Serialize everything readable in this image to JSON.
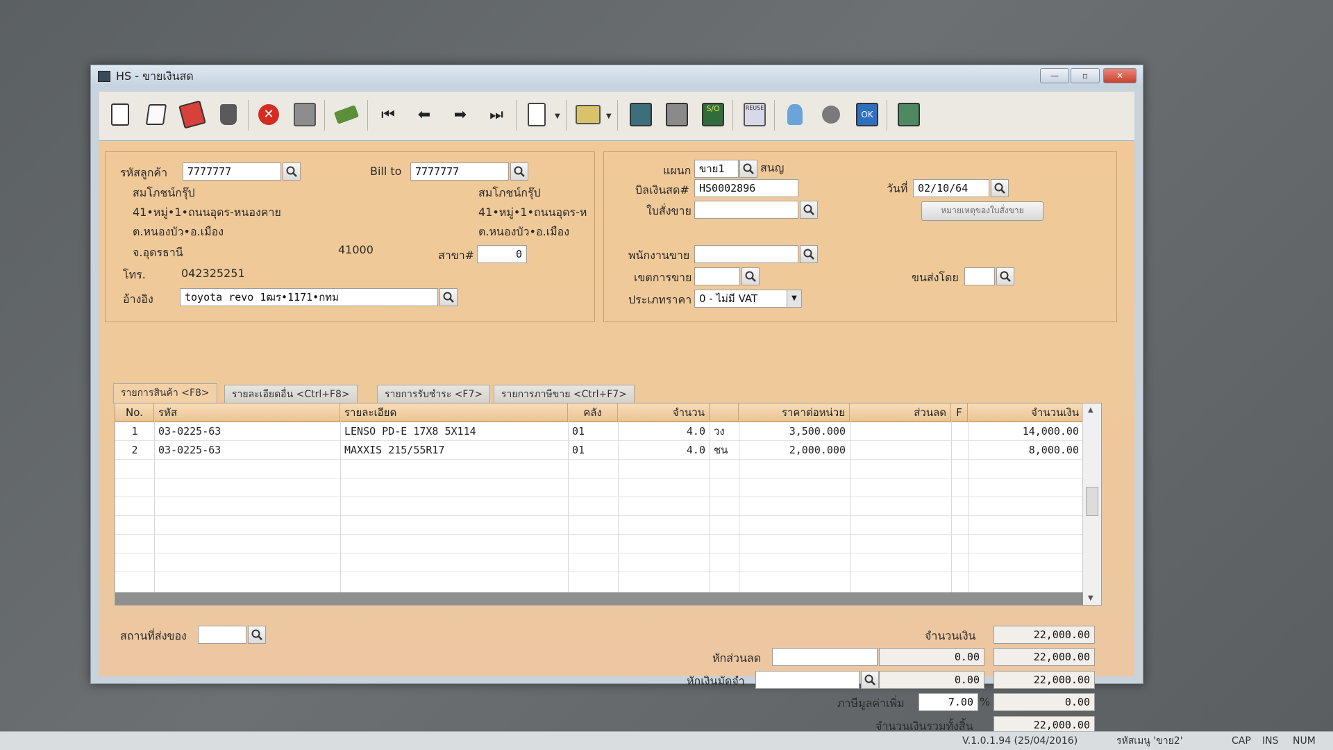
{
  "window": {
    "title": "HS - ขายเงินสด",
    "min": "—",
    "max": "▫",
    "close": "✕"
  },
  "toolbar": {
    "items": [
      "new-icon",
      "edit-icon",
      "void-icon",
      "delete-icon",
      "cancel-icon",
      "save-icon",
      "copy-icon",
      "first-icon",
      "prev-icon",
      "next-icon",
      "last-icon",
      "search-doc-icon",
      "print-icon",
      "calc-icon",
      "post-icon",
      "so-icon",
      "reuse-icon",
      "approve-icon",
      "tool-icon",
      "ok-icon",
      "export-icon"
    ],
    "labels": {
      "so": "S/O",
      "reuse": "REUSE",
      "ok": "OK"
    }
  },
  "customer": {
    "code_label": "รหัสลูกค้า",
    "code": "7777777",
    "billto_label": "Bill to",
    "billto": "7777777",
    "name": "สมโภชน์กรุ๊ป",
    "addr1": "41•หมู่•1•ถนนอุดร-หนองคาย",
    "addr2": "ต.หนองบัว•อ.เมือง",
    "addr3": "จ.อุดรธานี",
    "zip": "41000",
    "bill_name": "สมโภชน์กรุ๊ป",
    "bill_addr1": "41•หมู่•1•ถนนอุดร-ห",
    "bill_addr2": "ต.หนองบัว•อ.เมือง",
    "branch_label": "สาขา#",
    "branch": "0",
    "tel_label": "โทร.",
    "tel": "042325251",
    "ref_label": "อ้างอิง",
    "ref": "toyota revo 1ฒร•1171•กทม"
  },
  "doc": {
    "dept_label": "แผนก",
    "dept": "ขาย1",
    "dept_name": "สนญ",
    "billno_label": "บิลเงินสด#",
    "billno": "HS0002896",
    "date_label": "วันที่",
    "date": "02/10/64",
    "so_label": "ใบสั่งขาย",
    "so": "",
    "so_note_button": "หมายเหตุของใบสั่งขาย",
    "sales_label": "พนักงานขาย",
    "sales": "",
    "area_label": "เขตการขาย",
    "area": "",
    "ship_label": "ขนส่งโดย",
    "ship": "",
    "price_type_label": "ประเภทราคา",
    "price_type": "0 - ไม่มี VAT"
  },
  "tabs": [
    "รายการสินค้า <F8>",
    "รายละเอียดอื่น <Ctrl+F8>",
    "รายการรับชำระ <F7>",
    "รายการภาษีขาย <Ctrl+F7>"
  ],
  "grid": {
    "headers": [
      "No.",
      "รหัส",
      "รายละเอียด",
      "คลัง",
      "จำนวน",
      "",
      "ราคาต่อหน่วย",
      "ส่วนลด",
      "F",
      "จำนวนเงิน"
    ],
    "rows": [
      [
        "1",
        "03-0225-63",
        "LENSO PD-E 17X8 5X114",
        "01",
        "4.0",
        "วง",
        "3,500.000",
        "",
        "",
        "14,000.00"
      ],
      [
        "2",
        "03-0225-63",
        "MAXXIS 215/55R17",
        "01",
        "4.0",
        "ชน",
        "2,000.000",
        "",
        "",
        "8,000.00"
      ]
    ]
  },
  "footer": {
    "ship_place_label": "สถานที่ส่งของ",
    "ship_place": "",
    "amount_label": "จำนวนเงิน",
    "amount": "22,000.00",
    "discount_label": "หักส่วนลด",
    "discount_text": "",
    "discount_value": "0.00",
    "discount_total": "22,000.00",
    "deposit_label": "หักเงินมัดจำ",
    "deposit_text": "",
    "deposit_value": "0.00",
    "deposit_total": "22,000.00",
    "vat_label": "ภาษีมูลค่าเพิ่ม",
    "vat_rate": "7.00",
    "vat_pct": "%",
    "vat_amount": "0.00",
    "grand_label": "จำนวนเงินรวมทั้งสิ้น",
    "grand": "22,000.00"
  },
  "statusbar": {
    "version": "V.1.0.1.94 (25/04/2016)",
    "user": "รหัสเมนู 'ขาย2'",
    "cap": "CAP",
    "ins": "INS",
    "num": "NUM"
  }
}
